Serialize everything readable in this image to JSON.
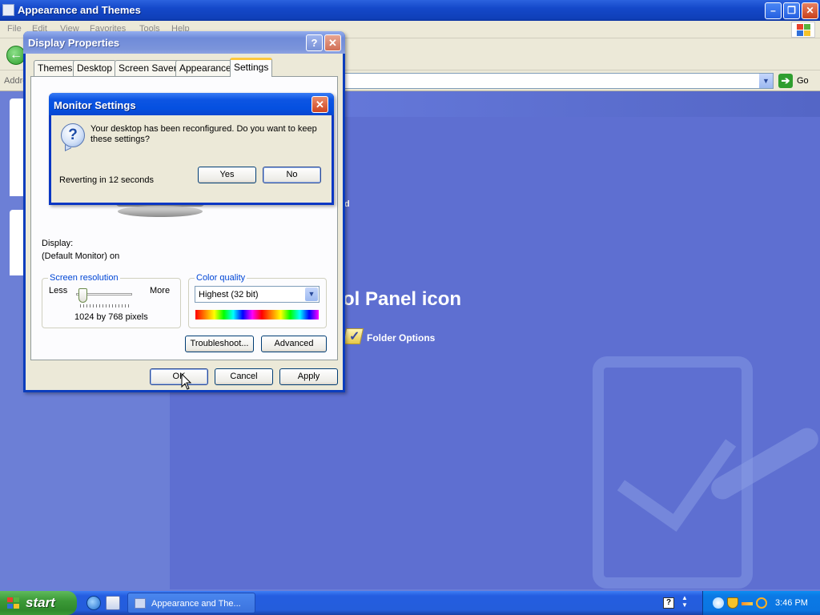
{
  "explorer": {
    "title": "Appearance and Themes",
    "menu": [
      "File",
      "Edit",
      "View",
      "Favorites",
      "Tools",
      "Help"
    ],
    "address_label": "Address",
    "go_label": "Go",
    "heading_fragment": "ol Panel icon",
    "left_fragment": "d",
    "folder_options_label": "Folder Options"
  },
  "display_properties": {
    "title": "Display Properties",
    "tabs": [
      "Themes",
      "Desktop",
      "Screen Saver",
      "Appearance",
      "Settings"
    ],
    "active_tab": "Settings",
    "display_label": "Display:",
    "display_value": "(Default Monitor) on",
    "screen_resolution": {
      "title": "Screen resolution",
      "less": "Less",
      "more": "More",
      "value": "1024 by 768 pixels"
    },
    "color_quality": {
      "title": "Color quality",
      "selected": "Highest (32 bit)"
    },
    "buttons": {
      "troubleshoot": "Troubleshoot...",
      "advanced": "Advanced",
      "ok": "OK",
      "cancel": "Cancel",
      "apply": "Apply"
    }
  },
  "monitor_settings": {
    "title": "Monitor Settings",
    "message": "Your desktop has been reconfigured.  Do you want to keep these settings?",
    "countdown": "Reverting in 12 seconds",
    "yes": "Yes",
    "no": "No"
  },
  "taskbar": {
    "start": "start",
    "task_item": "Appearance and The...",
    "clock": "3:46 PM"
  },
  "colors": {
    "desktop_blue": "#6b7fd7",
    "titlebar_blue": "#0550e0",
    "dialog_face": "#ece9d8",
    "group_title_blue": "#0046d5"
  }
}
